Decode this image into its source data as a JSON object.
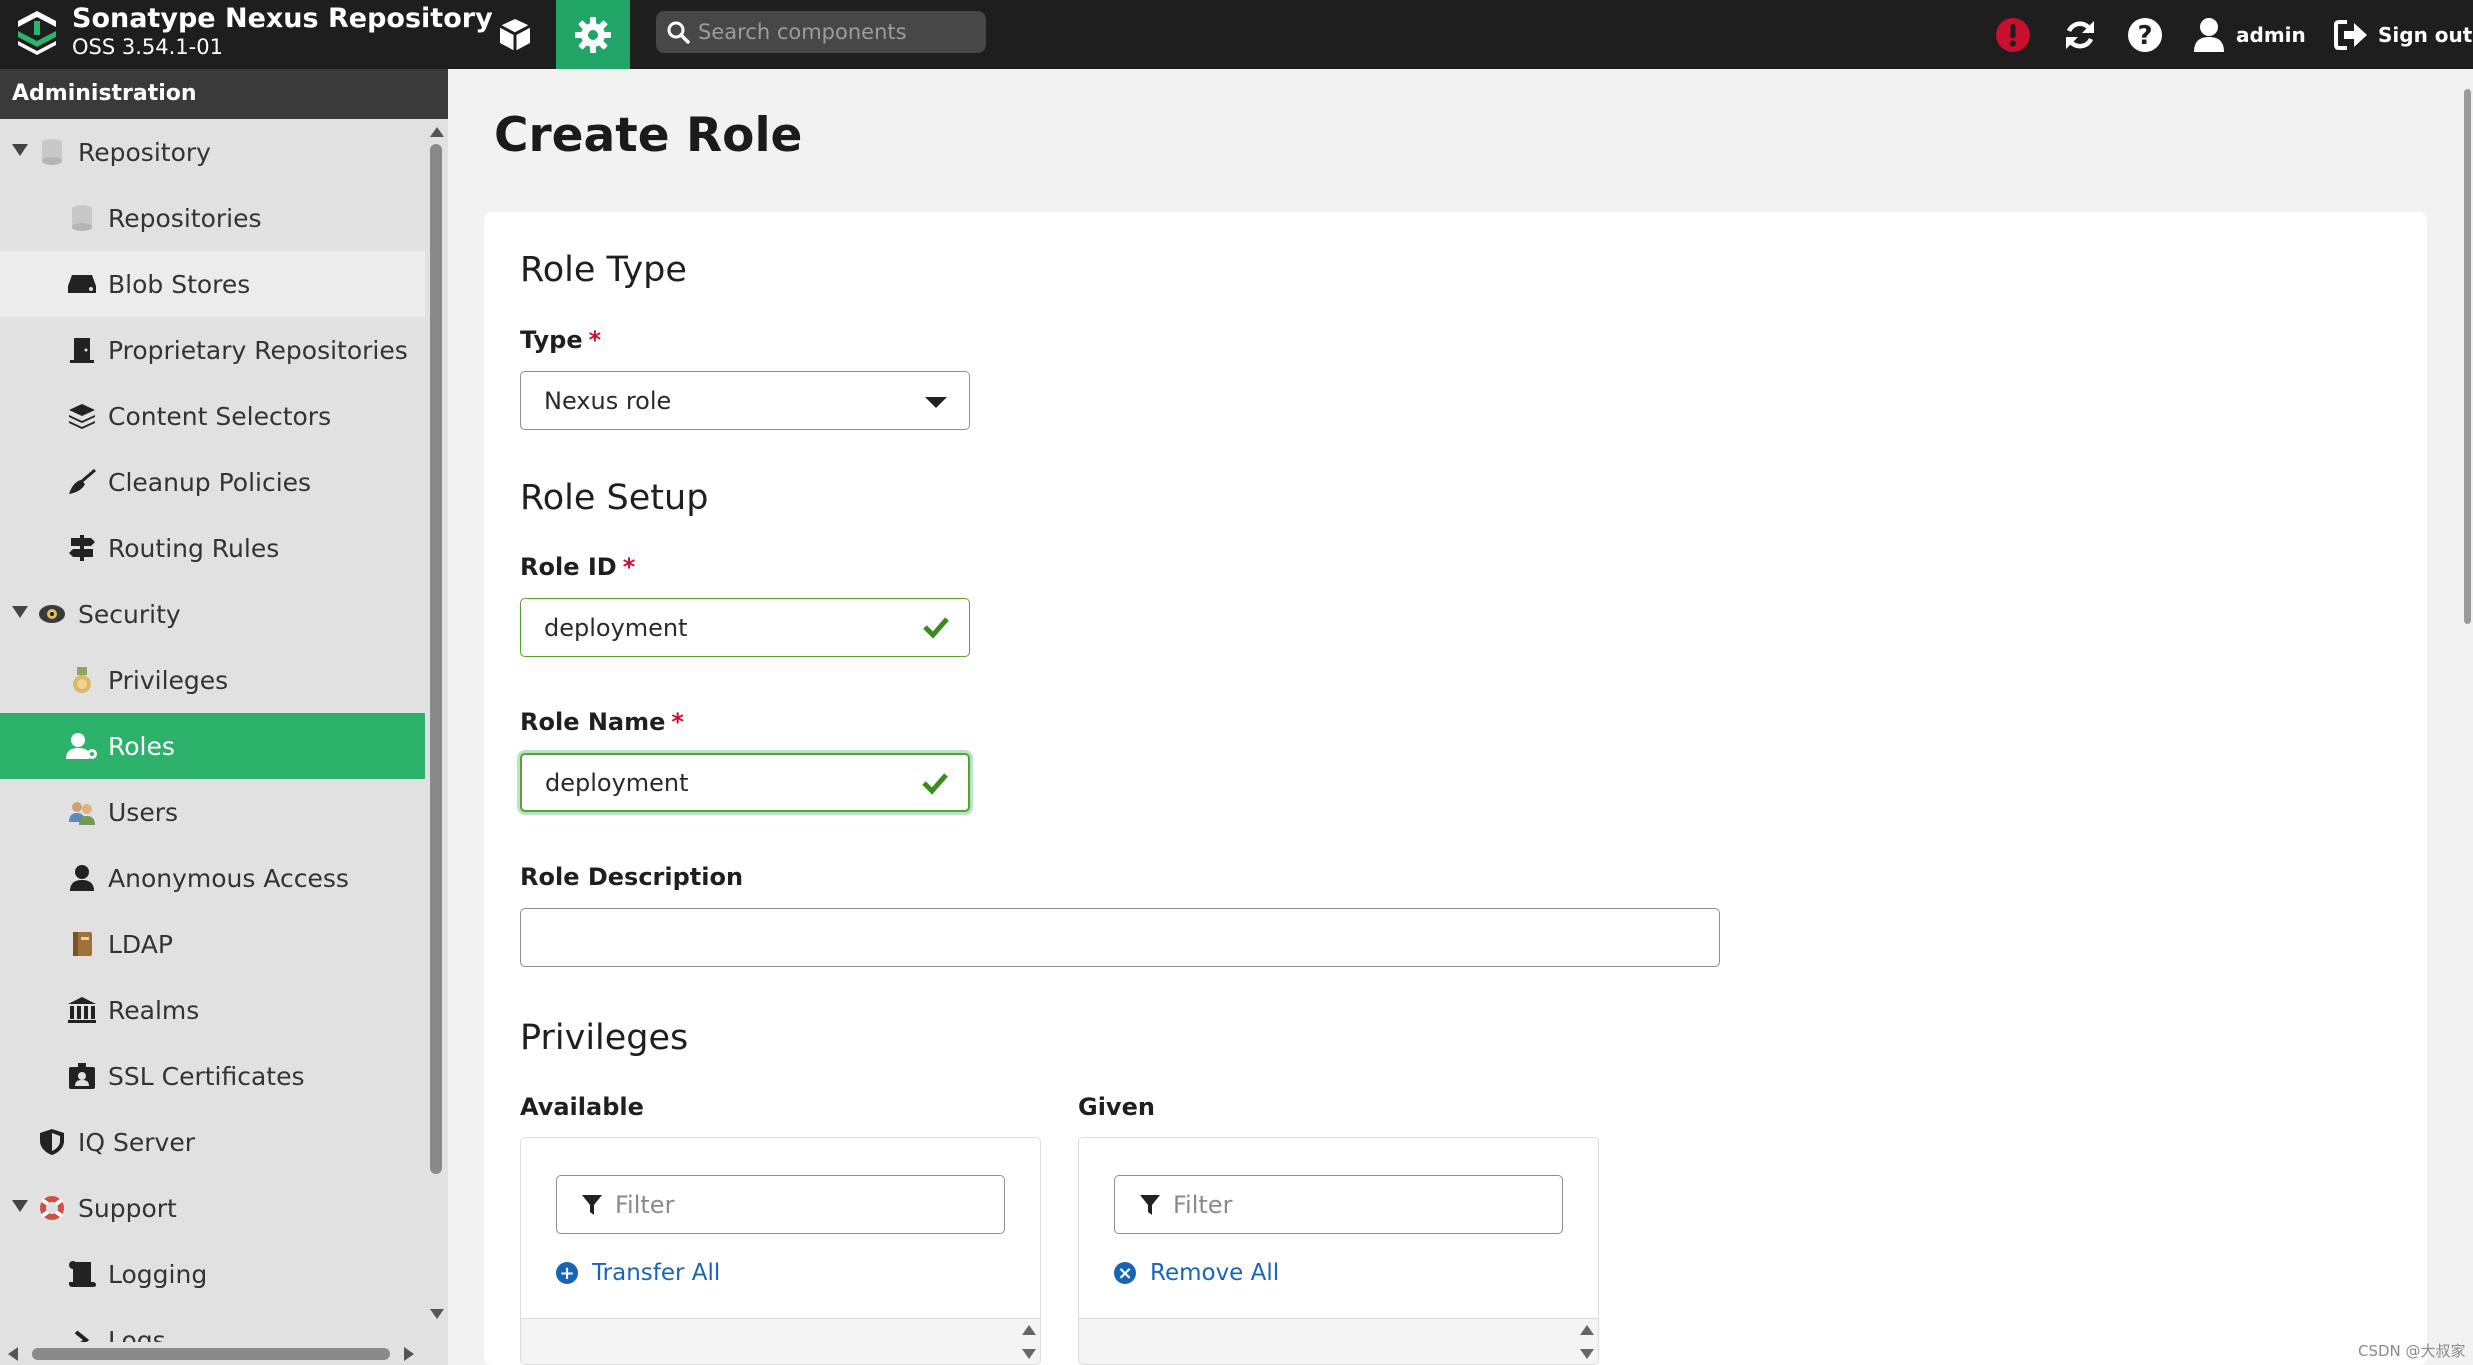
{
  "header": {
    "brand_name": "Sonatype Nexus Repository",
    "brand_version": "OSS 3.54.1-01",
    "search_placeholder": "Search components",
    "user_label": "admin",
    "signout_label": "Sign out",
    "accent_color": "#21a567",
    "icons": [
      "cube-icon",
      "gear-icon",
      "search-icon",
      "alert-icon",
      "refresh-icon",
      "help-icon",
      "user-icon",
      "sign-out-icon"
    ]
  },
  "sidebar": {
    "title": "Administration",
    "items": [
      {
        "label": "Repository",
        "icon": "database-icon"
      },
      {
        "label": "Repositories",
        "icon": "database-icon"
      },
      {
        "label": "Blob Stores",
        "icon": "hdd-icon"
      },
      {
        "label": "Proprietary Repositories",
        "icon": "door-icon"
      },
      {
        "label": "Content Selectors",
        "icon": "layers-icon"
      },
      {
        "label": "Cleanup Policies",
        "icon": "broom-icon"
      },
      {
        "label": "Routing Rules",
        "icon": "signpost-icon"
      },
      {
        "label": "Security",
        "icon": "eye-icon"
      },
      {
        "label": "Privileges",
        "icon": "medal-icon"
      },
      {
        "label": "Roles",
        "icon": "user-role-icon"
      },
      {
        "label": "Users",
        "icon": "users-icon"
      },
      {
        "label": "Anonymous Access",
        "icon": "user-icon"
      },
      {
        "label": "LDAP",
        "icon": "book-icon"
      },
      {
        "label": "Realms",
        "icon": "building-icon"
      },
      {
        "label": "SSL Certificates",
        "icon": "id-badge-icon"
      },
      {
        "label": "IQ Server",
        "icon": "shield-icon"
      },
      {
        "label": "Support",
        "icon": "lifebuoy-icon"
      },
      {
        "label": "Logging",
        "icon": "scroll-icon"
      },
      {
        "label": "Logs",
        "icon": "chevron-right-icon"
      }
    ],
    "active_item": "Roles"
  },
  "page": {
    "title": "Create Role",
    "role_type_title": "Role Type",
    "type_label": "Type",
    "type_value": "Nexus role",
    "role_setup_title": "Role Setup",
    "role_id_label": "Role ID",
    "role_id_value": "deployment",
    "role_name_label": "Role Name",
    "role_name_value": "deployment",
    "role_description_label": "Role Description",
    "role_description_value": "",
    "required_marker": "*",
    "privileges_title": "Privileges",
    "available_label": "Available",
    "given_label": "Given",
    "filter_placeholder": "Filter",
    "transfer_all_label": "Transfer All",
    "remove_all_label": "Remove All"
  },
  "watermark": "CSDN @大叔家"
}
